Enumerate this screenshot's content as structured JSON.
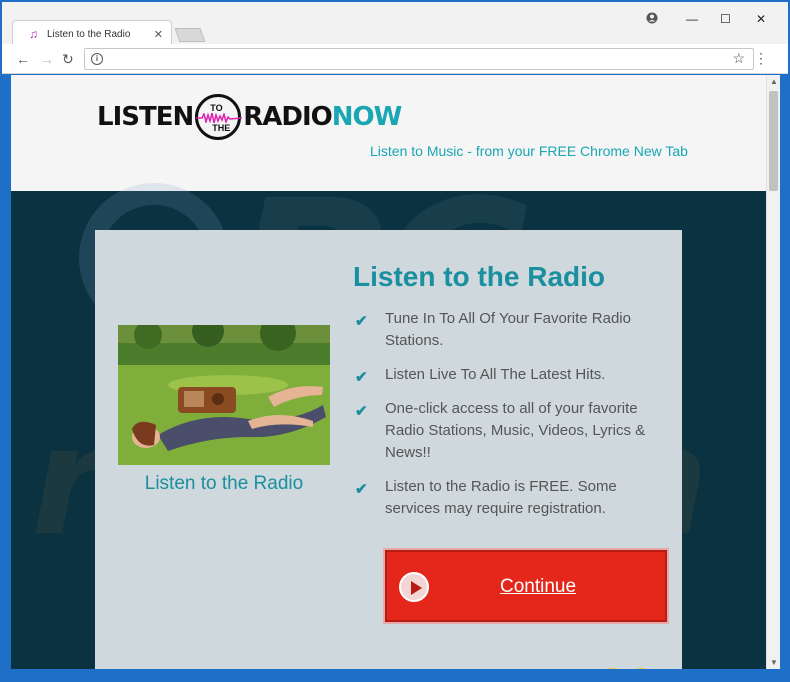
{
  "browser": {
    "tab_title": "Listen to the Radio",
    "tab_icon": "music-note-icon",
    "tab_close": "✕",
    "url": "",
    "controls": {
      "account": "account-icon",
      "minimize": "—",
      "maximize": "☐",
      "close": "✕"
    }
  },
  "header": {
    "logo_listen": "LISTEN",
    "logo_to": "TO",
    "logo_the": "THE",
    "logo_radio": "RADIO",
    "logo_now": "NOW",
    "tagline": "Listen to Music - from your FREE Chrome New Tab"
  },
  "card": {
    "title": "Listen to the Radio",
    "photo_caption": "Listen to the Radio",
    "features": [
      "Tune In To All Of Your Favorite Radio Stations.",
      "Listen Live To All The Latest Hits.",
      "One-click access to all of your favorite Radio Stations, Music, Videos, Lyrics & News!!",
      "Listen to the Radio is FREE. Some services may require registration."
    ],
    "continue_label": "Continue"
  },
  "colors": {
    "accent": "#1aa6b3",
    "title": "#1a8fa0",
    "button": "#e5271b",
    "dark_band": "#0a3240"
  }
}
